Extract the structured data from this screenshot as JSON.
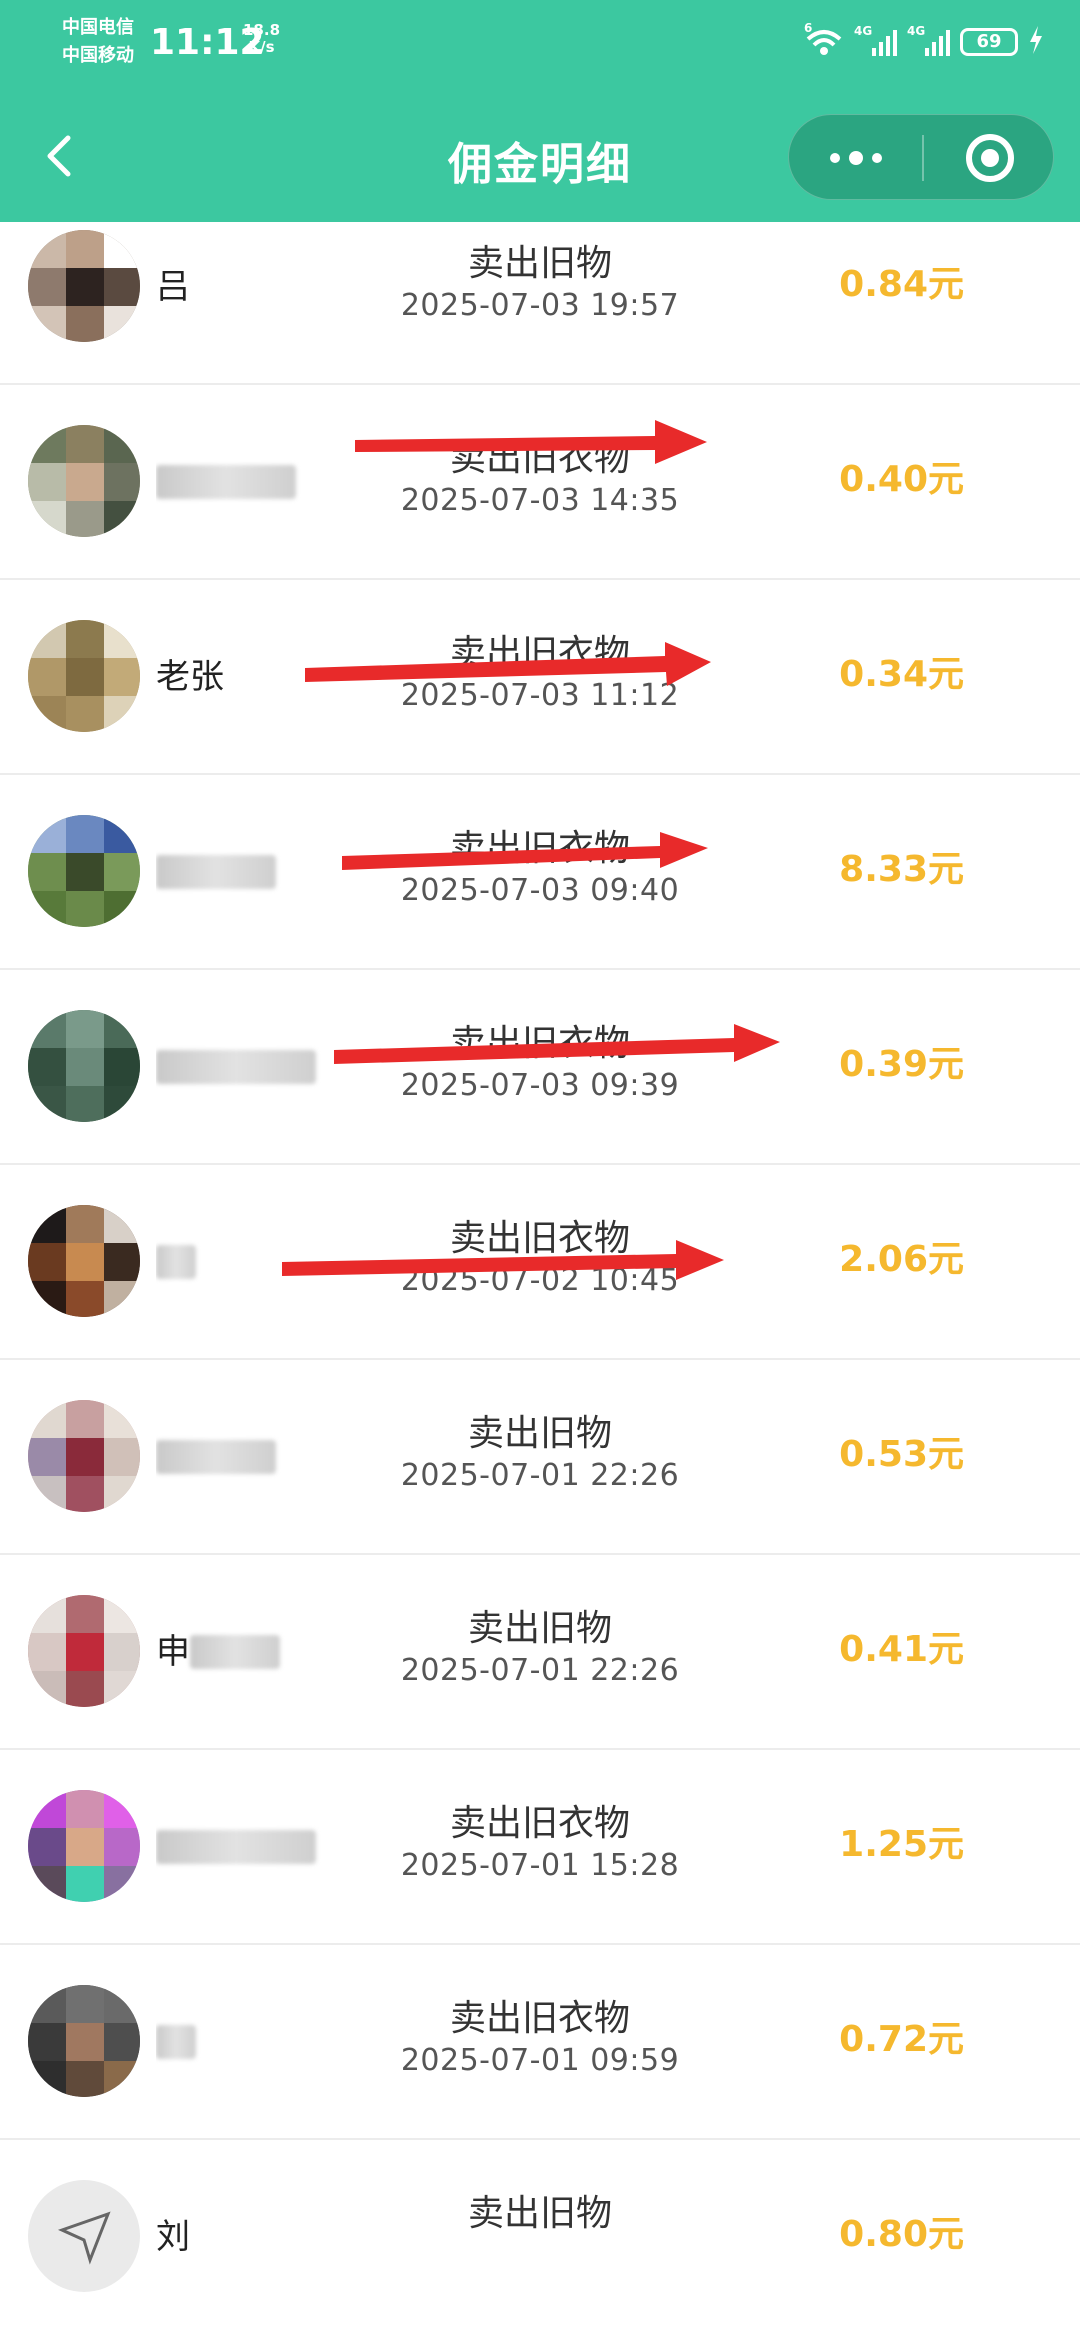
{
  "status_bar": {
    "carrier_1": "中国电信",
    "carrier_2": "中国移动",
    "time": "11:12",
    "net_speed_value": "18.8",
    "net_speed_unit": "K/s",
    "wifi_tag": "6",
    "signal_1_tag": "4G",
    "signal_2_tag": "4G",
    "battery": "69"
  },
  "nav": {
    "title": "佣金明细"
  },
  "colors": {
    "header": "#3cc8a0",
    "amount": "#f5b82e",
    "arrow": "#e82a2a"
  },
  "records": [
    {
      "name": "吕",
      "type": "卖出旧物",
      "date": "2025-07-03 19:57",
      "amount": "0.84元"
    },
    {
      "name": "",
      "type": "卖出旧衣物",
      "date": "2025-07-03 14:35",
      "amount": "0.40元"
    },
    {
      "name": "老张",
      "type": "卖出旧衣物",
      "date": "2025-07-03 11:12",
      "amount": "0.34元"
    },
    {
      "name": "",
      "type": "卖出旧衣物",
      "date": "2025-07-03 09:40",
      "amount": "8.33元"
    },
    {
      "name": "",
      "type": "卖出旧衣物",
      "date": "2025-07-03 09:39",
      "amount": "0.39元"
    },
    {
      "name": "",
      "type": "卖出旧衣物",
      "date": "2025-07-02 10:45",
      "amount": "2.06元"
    },
    {
      "name": "",
      "type": "卖出旧物",
      "date": "2025-07-01 22:26",
      "amount": "0.53元"
    },
    {
      "name": "申",
      "type": "卖出旧物",
      "date": "2025-07-01 22:26",
      "amount": "0.41元"
    },
    {
      "name": "",
      "type": "卖出旧衣物",
      "date": "2025-07-01 15:28",
      "amount": "1.25元"
    },
    {
      "name": "",
      "type": "卖出旧衣物",
      "date": "2025-07-01 09:59",
      "amount": "0.72元"
    },
    {
      "name": "刘",
      "type": "卖出旧物",
      "date": "",
      "amount": "0.80元"
    }
  ]
}
